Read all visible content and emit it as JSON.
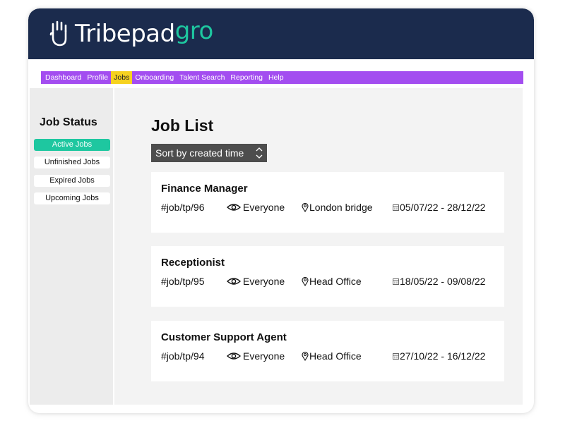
{
  "brand": {
    "name": "Tribepad",
    "accent_text": "gro",
    "header_color": "#1b2b4d",
    "accent_color": "#1ec7a0",
    "hand_icon": "hand-logo-icon"
  },
  "nav": {
    "bar_color": "#a34df0",
    "active_color": "#f6d21f",
    "items": [
      {
        "label": "Dashboard",
        "active": false
      },
      {
        "label": "Profile",
        "active": false
      },
      {
        "label": "Jobs",
        "active": true
      },
      {
        "label": "Onboarding",
        "active": false
      },
      {
        "label": "Talent Search",
        "active": false
      },
      {
        "label": "Reporting",
        "active": false
      },
      {
        "label": "Help",
        "active": false
      }
    ]
  },
  "sidebar": {
    "title": "Job Status",
    "items": [
      {
        "label": "Active Jobs",
        "active": true
      },
      {
        "label": "Unfinished Jobs",
        "active": false
      },
      {
        "label": "Expired Jobs",
        "active": false
      },
      {
        "label": "Upcoming Jobs",
        "active": false
      }
    ]
  },
  "main": {
    "title": "Job List",
    "sort_label": "Sort by created time",
    "jobs": [
      {
        "title": "Finance Manager",
        "ref": "#job/tp/96",
        "visibility": "Everyone",
        "location": "London bridge",
        "dates": "05/07/22 - 28/12/22"
      },
      {
        "title": "Receptionist",
        "ref": "#job/tp/95",
        "visibility": "Everyone",
        "location": "Head Office",
        "dates": "18/05/22 - 09/08/22"
      },
      {
        "title": "Customer Support Agent",
        "ref": "#job/tp/94",
        "visibility": "Everyone",
        "location": "Head Office",
        "dates": "27/10/22 - 16/12/22"
      }
    ]
  }
}
